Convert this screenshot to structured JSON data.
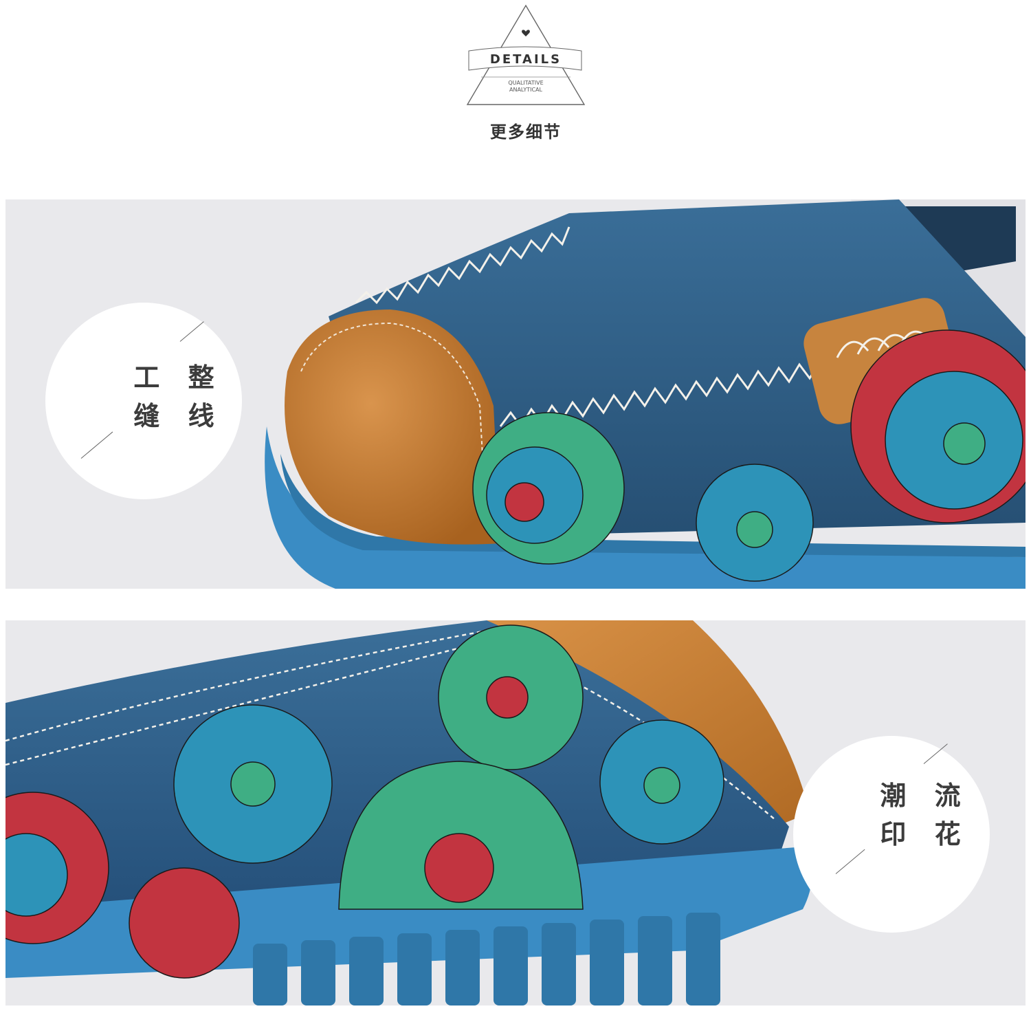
{
  "header": {
    "badge_title": "DETAILS",
    "badge_subtitle_1": "QUALITATIVE",
    "badge_subtitle_2": "ANALYTICAL",
    "caption": "更多细节"
  },
  "panel_1": {
    "callout_line_1": "工 整",
    "callout_line_2": "缝 线"
  },
  "panel_2": {
    "callout_line_1": "潮 流",
    "callout_line_2": "印 花"
  },
  "colors": {
    "leather_blue": "#2c5f86",
    "sole_blue": "#3a8cc4",
    "toe_tan": "#c07a33",
    "flower_red": "#c23440",
    "flower_green": "#3fae84",
    "flower_teal": "#2d93b8",
    "panel_bg": "#e9e9ec"
  }
}
